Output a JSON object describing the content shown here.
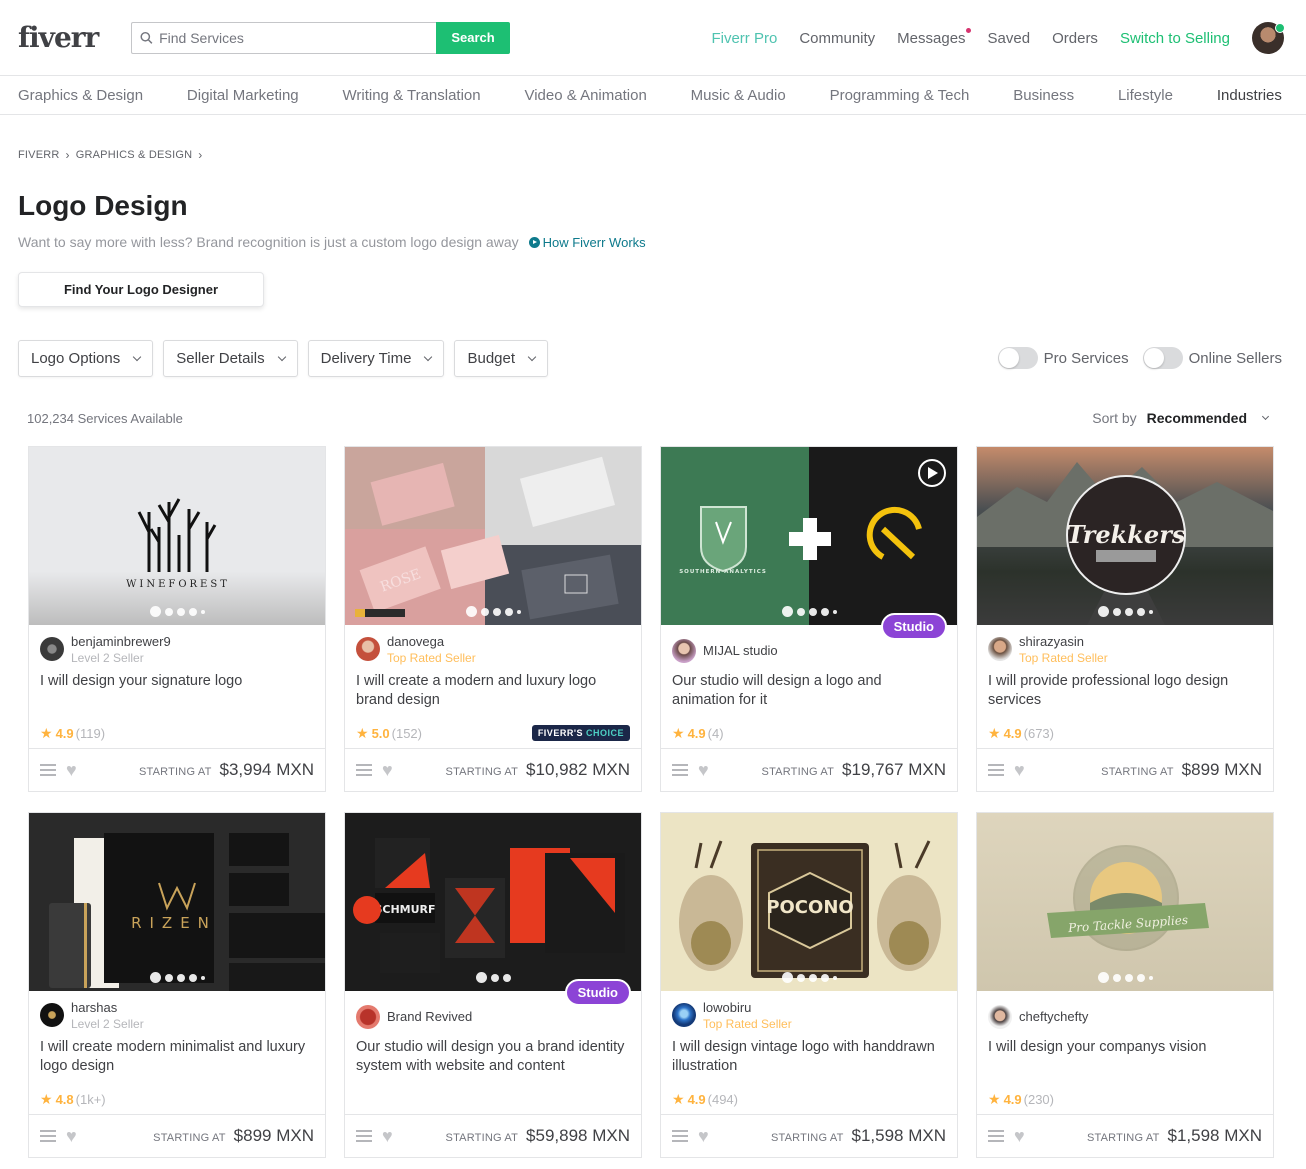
{
  "header": {
    "logo": "fiverr",
    "search_placeholder": "Find Services",
    "search_button": "Search",
    "nav": [
      {
        "label": "Fiverr Pro",
        "style": "teal"
      },
      {
        "label": "Community",
        "style": "plain"
      },
      {
        "label": "Messages",
        "style": "plain",
        "notification": true
      },
      {
        "label": "Saved",
        "style": "plain"
      },
      {
        "label": "Orders",
        "style": "plain"
      },
      {
        "label": "Switch to Selling",
        "style": "green"
      }
    ]
  },
  "categories": [
    "Graphics & Design",
    "Digital Marketing",
    "Writing & Translation",
    "Video & Animation",
    "Music & Audio",
    "Programming & Tech",
    "Business",
    "Lifestyle",
    "Industries"
  ],
  "breadcrumb": [
    "FIVERR",
    "GRAPHICS & DESIGN"
  ],
  "page": {
    "title": "Logo Design",
    "subtitle": "Want to say more with less? Brand recognition is just a custom logo design away",
    "how_link": "How Fiverr Works",
    "find_button": "Find Your Logo Designer"
  },
  "filters": [
    "Logo Options",
    "Seller Details",
    "Delivery Time",
    "Budget"
  ],
  "toggles": [
    {
      "label": "Pro Services",
      "on": false
    },
    {
      "label": "Online Sellers",
      "on": false
    }
  ],
  "results": {
    "count": "102,234 Services Available",
    "sort_label": "Sort by",
    "sort_value": "Recommended"
  },
  "colors": {
    "brand_green": "#1dbf73",
    "studio_purple": "#8c44d6",
    "star": "#ffb33e"
  },
  "gigs": [
    {
      "seller": "benjaminbrewer9",
      "level": "Level 2 Seller",
      "title": "I will design your signature logo",
      "rating": "4.9",
      "reviews": "(119)",
      "starting": "STARTING AT",
      "price": "$3,994 MXN",
      "thumb_text": "WINEFOREST",
      "studio": false,
      "choice": false
    },
    {
      "seller": "danovega",
      "level": "Top Rated Seller",
      "title": "I will create a modern and luxury logo brand design",
      "rating": "5.0",
      "reviews": "(152)",
      "starting": "STARTING AT",
      "price": "$10,982 MXN",
      "thumb_text": "ROSE",
      "studio": false,
      "choice": true,
      "choice_a": "FIVERR'S",
      "choice_b": "CHOICE"
    },
    {
      "seller": "MIJAL studio",
      "level": "",
      "title": "Our studio will design a logo and animation for it",
      "rating": "4.9",
      "reviews": "(4)",
      "starting": "STARTING AT",
      "price": "$19,767 MXN",
      "thumb_text": "SOUTHERN ANALYTICS",
      "studio": true,
      "studio_label": "Studio",
      "video": true,
      "choice": false
    },
    {
      "seller": "shirazyasin",
      "level": "Top Rated Seller",
      "title": "I will provide professional logo design services",
      "rating": "4.9",
      "reviews": "(673)",
      "starting": "STARTING AT",
      "price": "$899 MXN",
      "thumb_text": "Trekkers",
      "studio": false,
      "choice": false
    },
    {
      "seller": "harshas",
      "level": "Level 2 Seller",
      "title": "I will create modern minimalist and luxury logo design",
      "rating": "4.8",
      "reviews": "(1k+)",
      "starting": "STARTING AT",
      "price": "$899 MXN",
      "thumb_text": "RIZEN",
      "studio": false,
      "choice": false
    },
    {
      "seller": "Brand Revived",
      "level": "",
      "title": "Our studio will design you a brand identity system with website and content",
      "rating": "",
      "reviews": "",
      "starting": "STARTING AT",
      "price": "$59,898 MXN",
      "thumb_text": "SCHMURF",
      "studio": true,
      "studio_label": "Studio",
      "choice": false
    },
    {
      "seller": "lowobiru",
      "level": "Top Rated Seller",
      "title": "I will design vintage logo with handdrawn illustration",
      "rating": "4.9",
      "reviews": "(494)",
      "starting": "STARTING AT",
      "price": "$1,598 MXN",
      "thumb_text": "POCONO",
      "studio": false,
      "choice": false
    },
    {
      "seller": "cheftychefty",
      "level": "",
      "title": "I will design your companys vision",
      "rating": "4.9",
      "reviews": "(230)",
      "starting": "STARTING AT",
      "price": "$1,598 MXN",
      "thumb_text": "Pro Tackle Supplies",
      "studio": false,
      "choice": false
    }
  ]
}
